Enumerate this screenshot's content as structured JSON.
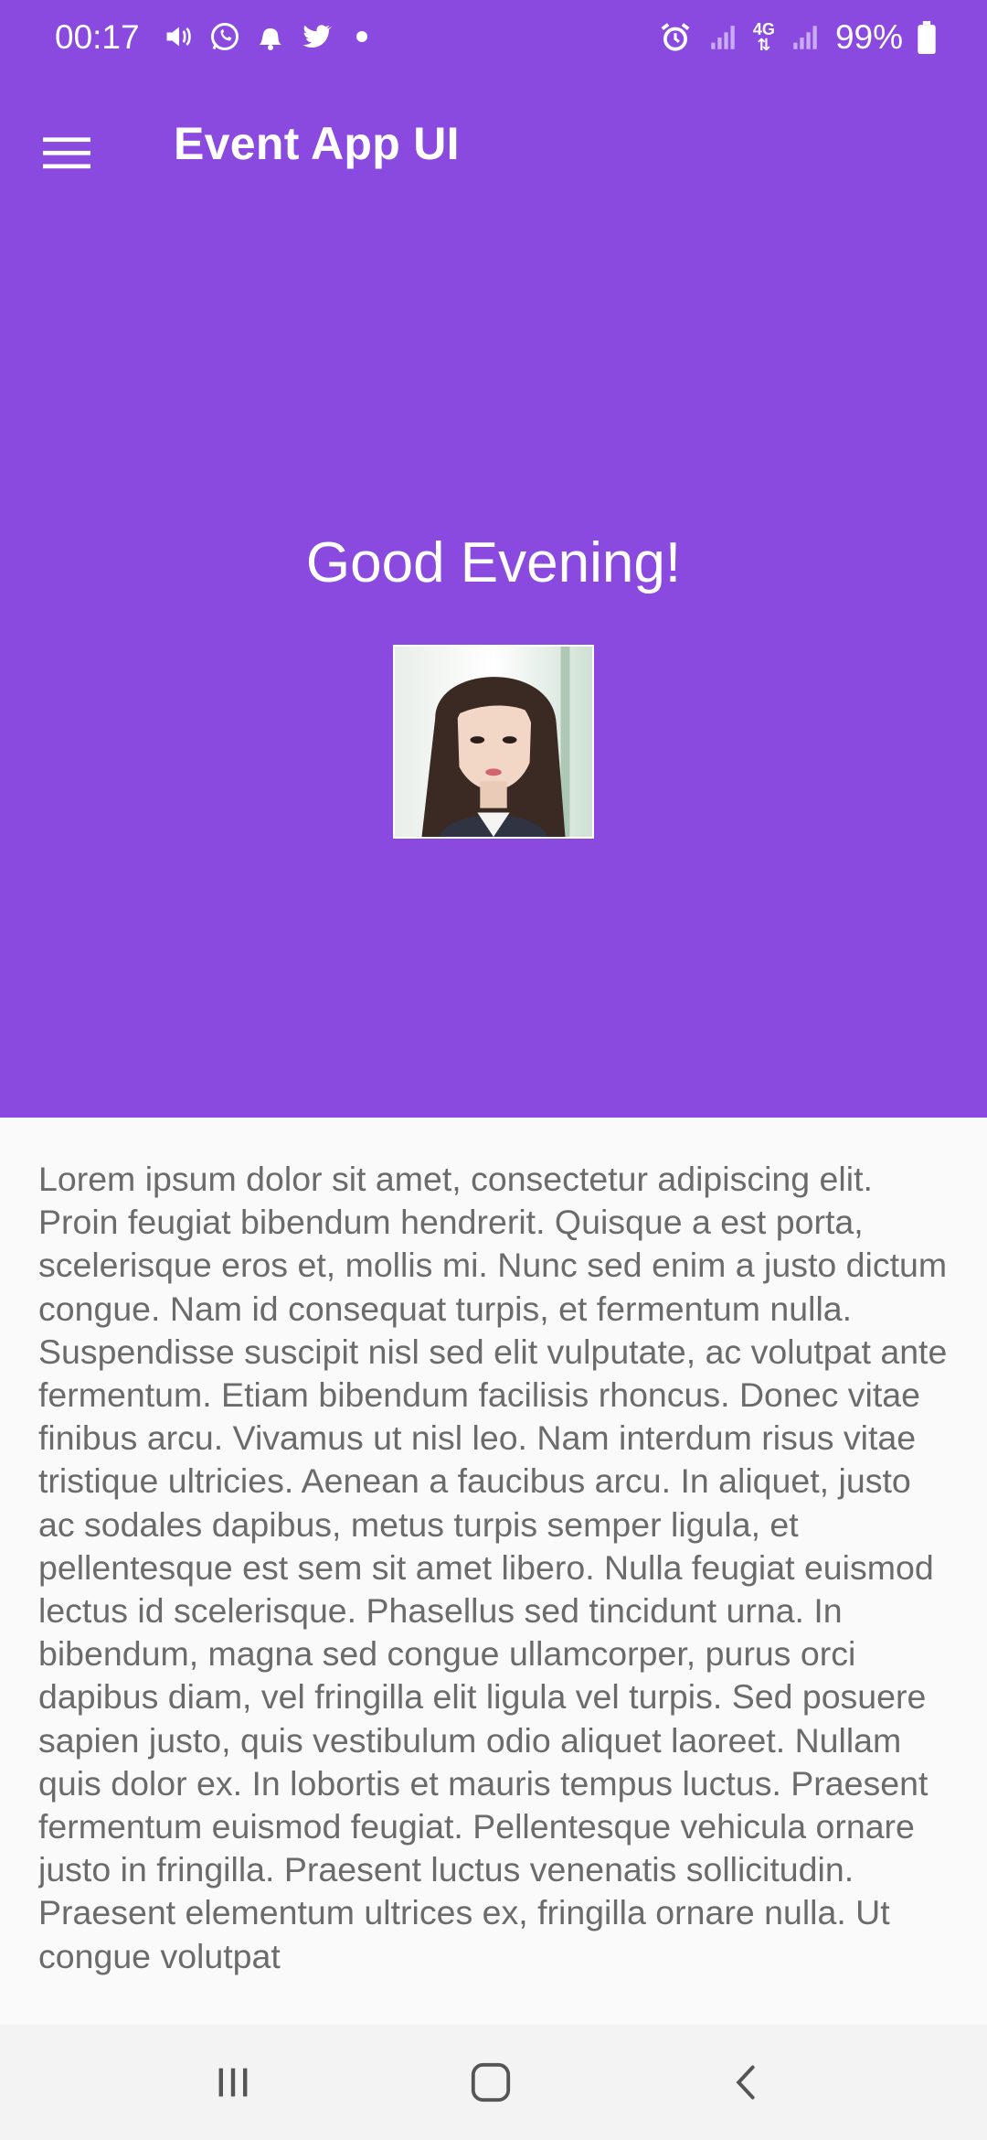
{
  "status_bar": {
    "time": "00:17",
    "battery": "99%",
    "network": "4G",
    "left_icons": [
      "volume-icon",
      "whatsapp-icon",
      "notification-bell-icon",
      "twitter-icon",
      "dot-icon"
    ],
    "right_icons": [
      "alarm-icon",
      "signal-icon",
      "network-4g-icon",
      "signal-icon",
      "battery-icon"
    ]
  },
  "app_bar": {
    "title": "Event App UI",
    "menu_icon": "hamburger-menu-icon"
  },
  "hero": {
    "greeting": "Good Evening!",
    "background_color": "#8a4ae0"
  },
  "content": {
    "body": "Lorem ipsum dolor sit amet, consectetur adipiscing elit. Proin feugiat bibendum hendrerit. Quisque a est porta, scelerisque eros et, mollis mi. Nunc sed enim a justo dictum congue. Nam id consequat turpis, et fermentum nulla. Suspendisse suscipit nisl sed elit vulputate, ac volutpat ante fermentum. Etiam bibendum facilisis rhoncus. Donec vitae finibus arcu. Vivamus ut nisl leo. Nam interdum risus vitae tristique ultricies. Aenean a faucibus arcu. In aliquet, justo ac sodales dapibus, metus turpis semper ligula, et pellentesque est sem sit amet libero. Nulla feugiat euismod lectus id scelerisque. Phasellus sed tincidunt urna. In bibendum, magna sed congue ullamcorper, purus orci dapibus diam, vel fringilla elit ligula vel turpis. Sed posuere sapien justo, quis vestibulum odio aliquet laoreet. Nullam quis dolor ex. In lobortis et mauris tempus luctus. Praesent fermentum euismod feugiat. Pellentesque vehicula ornare justo in fringilla. Praesent luctus venenatis sollicitudin. Praesent elementum ultrices ex, fringilla ornare nulla. Ut congue volutpat"
  },
  "nav_bar": {
    "buttons": [
      "recents-icon",
      "home-icon",
      "back-icon"
    ]
  }
}
